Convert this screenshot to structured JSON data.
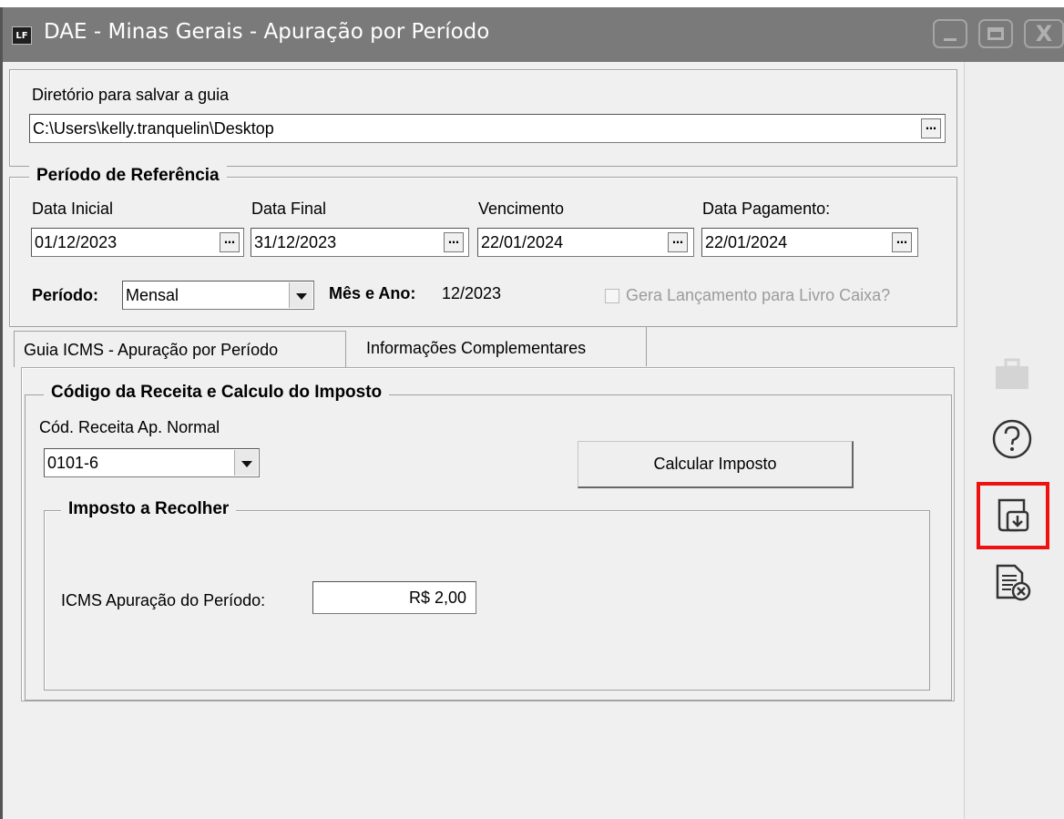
{
  "window": {
    "title": "DAE - Minas Gerais - Apuração por Período",
    "app_icon": "LF",
    "close_glyph": "X"
  },
  "directory": {
    "label": "Diretório para salvar a guia",
    "value": "C:\\Users\\kelly.tranquelin\\Desktop",
    "button": "…"
  },
  "reference": {
    "title": "Período de Referência",
    "fields": [
      {
        "label": "Data Inicial",
        "value": "01/12/2023"
      },
      {
        "label": "Data Final",
        "value": "31/12/2023"
      },
      {
        "label": "Vencimento",
        "value": "22/01/2024"
      },
      {
        "label": "Data Pagamento:",
        "value": "22/01/2024"
      }
    ],
    "periodo_label": "Período:",
    "periodo_value": "Mensal",
    "mes_ano_label": "Mês e Ano:",
    "mes_ano_value": "12/2023",
    "checkbox_label": "Gera Lançamento para Livro Caixa?"
  },
  "tabs": [
    "Guia ICMS - Apuração por Período",
    "Informações Complementares"
  ],
  "codigo": {
    "title": "Código da Receita e Calculo do Imposto",
    "receita_label": "Cód. Receita Ap. Normal",
    "receita_value": "0101-6",
    "calc_button": "Calcular Imposto"
  },
  "imposto": {
    "title": "Imposto a Recolher",
    "icms_label": "ICMS Apuração do Período:",
    "icms_value": "R$ 2,00"
  },
  "side_icons": [
    "briefcase-icon",
    "help-icon",
    "download-guide-icon",
    "cancel-document-icon"
  ],
  "highlight_color": "#ee1111"
}
